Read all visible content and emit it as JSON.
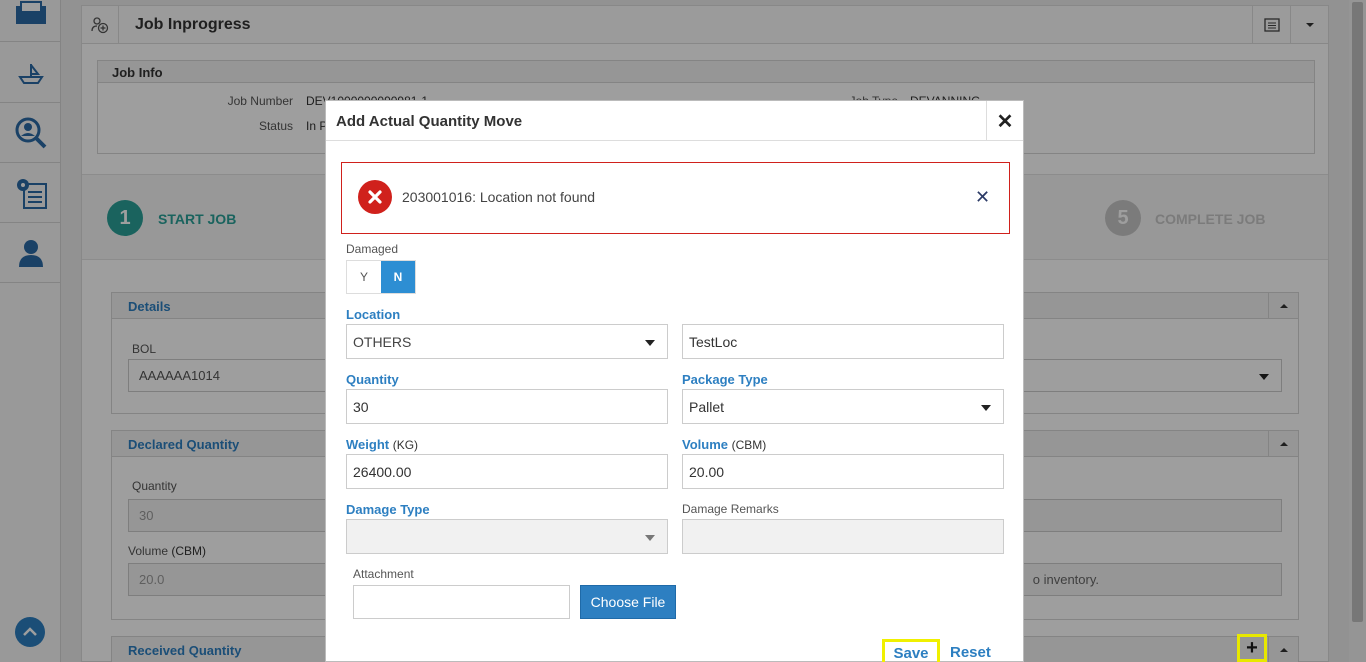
{
  "page": {
    "title": "Job Inprogress"
  },
  "job_info": {
    "title": "Job Info",
    "job_number_label": "Job Number",
    "job_number_value": "DEV1000000090981-1",
    "status_label": "Status",
    "status_value": "In P",
    "job_type_label": "Job Type",
    "job_type_value": "DEVANNING"
  },
  "steps": [
    {
      "number": "1",
      "label": "START JOB",
      "color": "#2aa198"
    },
    {
      "number": "5",
      "label": "COMPLETE JOB",
      "color": "#c7c7c7"
    }
  ],
  "panels": {
    "details": {
      "title": "Details",
      "bol_label": "BOL",
      "bol_value": "AAAAAA1014"
    },
    "declared": {
      "title": "Declared Quantity",
      "quantity_label": "Quantity",
      "quantity_value": "30",
      "volume_label": "Volume",
      "volume_unit": "(CBM)",
      "volume_value": "20.0",
      "note": "o inventory."
    },
    "received": {
      "title": "Received Quantity"
    }
  },
  "modal": {
    "title": "Add Actual Quantity Move",
    "close_glyph": "✕",
    "alert": {
      "message": "203001016: Location not found",
      "dismiss_glyph": "✕",
      "color": "#d0211c"
    },
    "damaged": {
      "label": "Damaged",
      "yes": "Y",
      "no": "N",
      "selected": "N"
    },
    "location": {
      "label": "Location",
      "value": "OTHERS",
      "text_value": "TestLoc"
    },
    "quantity": {
      "label": "Quantity",
      "value": "30"
    },
    "package_type": {
      "label": "Package Type",
      "value": "Pallet"
    },
    "weight": {
      "label": "Weight",
      "unit": "(KG)",
      "value": "26400.00"
    },
    "volume": {
      "label": "Volume",
      "unit": "(CBM)",
      "value": "20.00"
    },
    "damage_type": {
      "label": "Damage Type",
      "value": ""
    },
    "damage_remarks": {
      "label": "Damage Remarks",
      "value": ""
    },
    "attachment": {
      "label": "Attachment",
      "value": "",
      "button": "Choose File"
    },
    "save": "Save",
    "reset": "Reset"
  },
  "plus_glyph": "+",
  "colors": {
    "accent": "#2d7fc1",
    "error": "#d0211c",
    "highlight": "#f0f000"
  }
}
